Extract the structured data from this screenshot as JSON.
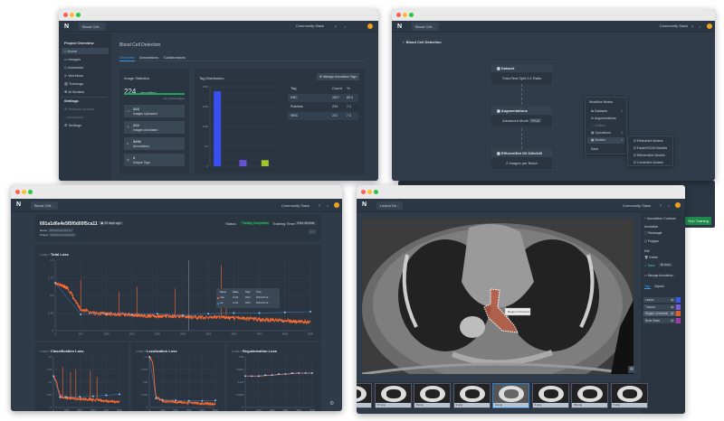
{
  "common": {
    "logo": "N",
    "community_label": "Community Slack",
    "project_selector": "Blood Cell...",
    "help_icon": "question-icon",
    "bell_icon": "bell-icon"
  },
  "overview_window": {
    "sidebar": {
      "section1": "Project Overview",
      "items": [
        {
          "label": "Home",
          "icon": "home-icon",
          "active": true
        },
        {
          "label": "Images",
          "icon": "images-icon"
        },
        {
          "label": "Annotator",
          "icon": "annotator-icon"
        },
        {
          "label": "Workflow",
          "icon": "workflow-icon"
        },
        {
          "label": "Trainings",
          "icon": "chart-icon"
        },
        {
          "label": "AI Models",
          "icon": "model-icon"
        }
      ],
      "section2": "Settings",
      "settings_items": [
        {
          "label": "Network Access",
          "disabled": true
        },
        {
          "label": "Advanced",
          "disabled": true
        },
        {
          "label": "Settings",
          "disabled": false
        }
      ]
    },
    "title": "Blood Cell Detection",
    "tabs": [
      "Overview",
      "Annotations",
      "Collaborators"
    ],
    "active_tab": "Overview",
    "image_statistics": {
      "title": "Image Statistics",
      "annotated_count": "224",
      "annotated_label": "annotated",
      "progress": 1.0,
      "progress_caption": "out of 224 images",
      "stats": [
        {
          "value": "224",
          "label": "Images Uploaded"
        },
        {
          "value": "224",
          "label": "Images Annotated"
        },
        {
          "value": "3292",
          "label": "Annotations"
        },
        {
          "value": "3",
          "label": "Unique Tags"
        }
      ]
    },
    "tag_distribution": {
      "title": "Tag Distribution",
      "manage_button": "Manage Annotation Tags",
      "table_headers": [
        "Tag",
        "Count",
        "%"
      ],
      "rows": [
        [
          "RBC",
          "2827",
          "85.9"
        ],
        [
          "Platelets",
          "234",
          "7.1"
        ],
        [
          "WBC",
          "231",
          "7.0"
        ]
      ]
    }
  },
  "chart_data": [
    {
      "type": "bar",
      "categories": [
        "RBC",
        "Platelets",
        "WBC"
      ],
      "values": [
        2827,
        234,
        231
      ],
      "colors": [
        "#3b4ff0",
        "#6a4fd8",
        "#a3c42a"
      ],
      "ylim": [
        0,
        3000
      ],
      "yticks": [
        "0",
        "750",
        "1500",
        "2250",
        "3000"
      ],
      "grid": true
    },
    {
      "type": "line",
      "title": "Total Loss",
      "breadcrumb": "Loss",
      "xlim": [
        0,
        5000
      ],
      "ylim": [
        0,
        1.0
      ],
      "xticks": [
        "0",
        "500",
        "1000",
        "1500",
        "2000",
        "2500",
        "3000",
        "3500",
        "4000",
        "4500",
        "5000"
      ],
      "yticks": [
        "0",
        "0.25",
        "0.5",
        "0.75",
        "1.0"
      ],
      "grid": true,
      "series": [
        {
          "name": "train",
          "color": "#ff6a30",
          "x": [
            0,
            250,
            500,
            750,
            1000,
            1250,
            1500,
            1750,
            2000,
            2250,
            2500,
            2750,
            3000,
            3250,
            3500,
            3750,
            4000,
            4250,
            4500,
            4750,
            5000
          ],
          "y": [
            0.68,
            0.6,
            0.3,
            0.25,
            0.24,
            0.23,
            0.22,
            0.21,
            0.21,
            0.2,
            0.2,
            0.19,
            0.19,
            0.19,
            0.18,
            0.17,
            0.16,
            0.15,
            0.14,
            0.13,
            0.12
          ],
          "spikes": [
            [
              500,
              0.72
            ],
            [
              1250,
              0.55
            ],
            [
              1600,
              0.62
            ],
            [
              2350,
              0.6
            ],
            [
              3250,
              0.93
            ],
            [
              3350,
              0.6
            ]
          ]
        },
        {
          "name": "val",
          "color": "#3a8ee0",
          "x": [
            0,
            500,
            1000,
            1500,
            2000,
            2500,
            3000,
            3500,
            4000,
            4500,
            5000
          ],
          "y": [
            0.68,
            0.23,
            0.24,
            0.23,
            0.24,
            0.22,
            0.24,
            0.25,
            0.25,
            0.26,
            0.27
          ]
        }
      ],
      "tooltip": {
        "headers": [
          "Name",
          "Value",
          "Step",
          "Time"
        ],
        "rows": [
          [
            "train",
            "0.211",
            "2612",
            "2023-05-12"
          ],
          [
            "val",
            "0.231",
            "2612",
            "2023-05-12"
          ]
        ]
      }
    },
    {
      "type": "line",
      "title": "Classification Loss",
      "breadcrumb": "Loss",
      "xlim": [
        0,
        5000
      ],
      "ylim": [
        0,
        1.0
      ],
      "xticks": [
        "0",
        "1000",
        "2000",
        "3000",
        "4000",
        "5000"
      ],
      "yticks": [
        "0",
        "0.25",
        "0.5",
        "0.75",
        "1.0"
      ],
      "grid": true,
      "series": [
        {
          "name": "train",
          "color": "#ff6a30",
          "x": [
            0,
            250,
            500,
            1000,
            2000,
            3000,
            4000,
            5000
          ],
          "y": [
            0.62,
            0.5,
            0.22,
            0.19,
            0.17,
            0.15,
            0.13,
            0.11
          ],
          "spikes": [
            [
              700,
              0.8
            ],
            [
              1300,
              0.7
            ],
            [
              1700,
              0.75
            ],
            [
              2800,
              0.72
            ],
            [
              3300,
              0.6
            ]
          ]
        },
        {
          "name": "val",
          "color": "#3a8ee0",
          "x": [
            0,
            500,
            1000,
            2000,
            3000,
            4000,
            5000
          ],
          "y": [
            0.62,
            0.2,
            0.2,
            0.21,
            0.22,
            0.24,
            0.26
          ]
        }
      ]
    },
    {
      "type": "line",
      "title": "Localization Loss",
      "breadcrumb": "Loss",
      "xlim": [
        0,
        5000
      ],
      "ylim": [
        0,
        0.1
      ],
      "xticks": [
        "0",
        "1000",
        "2000",
        "3000",
        "4000",
        "5000"
      ],
      "yticks": [
        "0",
        "0.025",
        "0.05",
        "0.075",
        "0.1"
      ],
      "grid": true,
      "series": [
        {
          "name": "train",
          "color": "#ff6a30",
          "x": [
            0,
            250,
            500,
            1000,
            2000,
            3000,
            4000,
            5000
          ],
          "y": [
            0.1,
            0.09,
            0.02,
            0.013,
            0.011,
            0.009,
            0.008,
            0.007
          ],
          "spikes": []
        },
        {
          "name": "val",
          "color": "#3a8ee0",
          "x": [
            0,
            500,
            1000,
            2000,
            3000,
            4000,
            5000
          ],
          "y": [
            0.1,
            0.018,
            0.015,
            0.014,
            0.013,
            0.013,
            0.014
          ]
        }
      ]
    },
    {
      "type": "line",
      "title": "Regularization Loss",
      "breadcrumb": "Loss",
      "xlim": [
        0,
        5000
      ],
      "ylim": [
        0,
        0.05
      ],
      "xticks": [
        "0",
        "1000",
        "2000",
        "3000",
        "4000",
        "5000"
      ],
      "yticks": [
        "0",
        "0.0125",
        "0.025",
        "0.0375",
        "0.05"
      ],
      "grid": true,
      "series": [
        {
          "name": "train",
          "color": "#ff6a30",
          "x": [
            0,
            1000,
            2000,
            3000,
            4000,
            5000
          ],
          "y": [
            0.031,
            0.031,
            0.032,
            0.033,
            0.034,
            0.034
          ],
          "spikes": []
        },
        {
          "name": "val",
          "color": "#3a8ee0",
          "x": [
            0,
            500,
            1000,
            1500,
            2000,
            2500,
            3000,
            3500,
            4000,
            4500,
            5000
          ],
          "y": [
            0.031,
            0.031,
            0.031,
            0.032,
            0.032,
            0.033,
            0.033,
            0.034,
            0.034,
            0.034,
            0.034
          ]
        }
      ]
    }
  ],
  "workflow_window": {
    "back_title": "Blood Cell Detection",
    "nodes": [
      {
        "title": "Dataset",
        "body": "Train/Test Split 0.2 Ratio"
      },
      {
        "title": "Augmentations",
        "body": "Advanced Mode",
        "badge": "TRUE"
      },
      {
        "title": "EfficientDet D0 640x640",
        "body": "2 Images per Batch"
      }
    ],
    "menu": {
      "title": "Workflow Nodes",
      "items": [
        {
          "label": "Datasets",
          "sub": true
        },
        {
          "label": "Augmentations"
        },
        {
          "label": "Outliers",
          "disabled": true
        },
        {
          "label": "Operations",
          "sub": true
        },
        {
          "label": "Models",
          "sub": true,
          "active": true
        }
      ],
      "save": "Save"
    },
    "submenu": [
      "RetinaNet Models",
      "FasterRCNN Models",
      "EfficientDet Models",
      "CenterNet Models"
    ]
  },
  "training_window": {
    "run_id": "691a1d6e4e5f5f0d00f5ca11",
    "age_badge": "29 days ago",
    "name_label": "Name",
    "name_value": "efficientdet-d0-run",
    "project_label": "Project",
    "project_value": "blood-cell-detection",
    "status_label": "Status:",
    "status_value": "Training Completed",
    "status_color": "#2fb36a",
    "time_label": "Training Time:",
    "time_value": "3 hrs 45 mins",
    "more": "···"
  },
  "annotator_window": {
    "project_selector": "Lesion De...",
    "polygon_label": "Region of Interest",
    "sidebar": {
      "title": "Annotation Controls",
      "annotation_header": "Annotation",
      "tools": [
        "Rectangle",
        "Polygon"
      ],
      "edit_header": "Edit",
      "delete": "Delete",
      "save": "Save",
      "undo": "Undo",
      "manage": "Manage Annotation...",
      "tabs": [
        "Tags",
        "Objects"
      ],
      "tags": [
        {
          "label": "Lesion",
          "color": "#3b5bf0"
        },
        {
          "label": "Tumour",
          "color": "#7b5be0"
        },
        {
          "label": "Region of Interest",
          "color": "#e0602a",
          "active": true
        },
        {
          "label": "Bone Mass",
          "color": "#a03ab0"
        }
      ]
    },
    "thumbnails": [
      "36.png",
      "37.png",
      "8.png",
      "9.png",
      "3.png",
      "4.png",
      "39.png",
      "5.png"
    ],
    "selected_thumbnail": 4,
    "run_training": "Run Training"
  }
}
